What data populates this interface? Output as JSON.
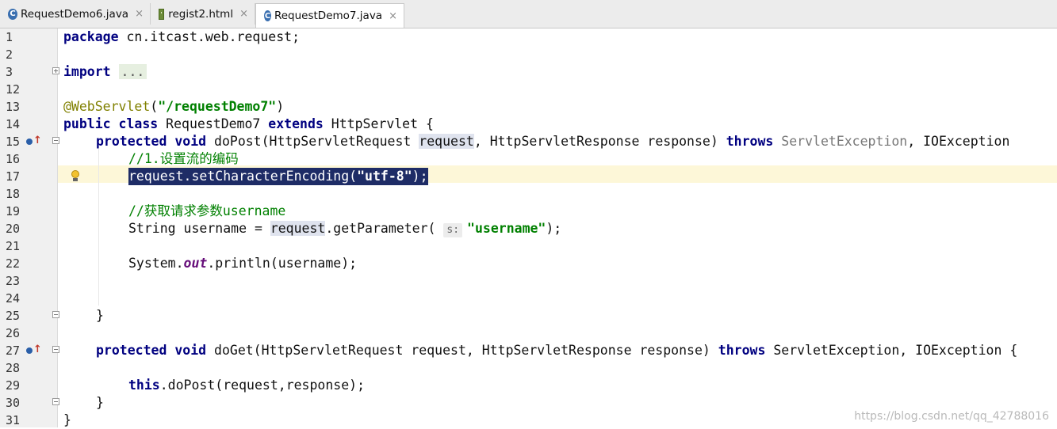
{
  "tabs": [
    {
      "label": "RequestDemo6.java",
      "icon": "class-icon",
      "close": "×"
    },
    {
      "label": "regist2.html",
      "icon": "html-file-icon",
      "close": "×"
    },
    {
      "label": "RequestDemo7.java",
      "icon": "class-icon",
      "close": "×",
      "active": true
    }
  ],
  "tab_icon_letter": "C",
  "lines": [
    {
      "n": "1"
    },
    {
      "n": "2"
    },
    {
      "n": "3"
    },
    {
      "n": "12"
    },
    {
      "n": "13"
    },
    {
      "n": "14"
    },
    {
      "n": "15"
    },
    {
      "n": "16"
    },
    {
      "n": "17"
    },
    {
      "n": "18"
    },
    {
      "n": "19"
    },
    {
      "n": "20"
    },
    {
      "n": "21"
    },
    {
      "n": "22"
    },
    {
      "n": "23"
    },
    {
      "n": "24"
    },
    {
      "n": "25"
    },
    {
      "n": "26"
    },
    {
      "n": "27"
    },
    {
      "n": "28"
    },
    {
      "n": "29"
    },
    {
      "n": "30"
    },
    {
      "n": "31"
    }
  ],
  "code": {
    "l1_kw": "package",
    "l1_rest": " cn.itcast.web.request;",
    "l3_kw": "import",
    "l3_dots": "...",
    "l13_ann": "@WebServlet",
    "l13_p1": "(",
    "l13_str": "\"/requestDemo7\"",
    "l13_p2": ")",
    "l14_kw1": "public class",
    "l14_mid": " RequestDemo7 ",
    "l14_kw2": "extends",
    "l14_rest": " HttpServlet {",
    "l15_kw1": "protected void",
    "l15_a": " doPost(HttpServletRequest ",
    "l15_req": "request",
    "l15_b": ", HttpServletResponse response) ",
    "l15_kw2": "throws",
    "l15_c": " ServletException",
    "l15_d": ", IOException",
    "l16_cmt": "//1.设置流的编码",
    "l17_a": "request.setCharacterEncoding(",
    "l17_str": "\"utf-8\"",
    "l17_b": ");",
    "l19_cmt": "//获取请求参数username",
    "l20_a": "String username = ",
    "l20_req": "request",
    "l20_b": ".getParameter( ",
    "l20_hint": "s:",
    "l20_str": "\"username\"",
    "l20_c": ");",
    "l22_a": "System.",
    "l22_out": "out",
    "l22_b": ".println(username);",
    "l25": "}",
    "l27_kw1": "protected void",
    "l27_a": " doGet(HttpServletRequest request, HttpServletResponse response) ",
    "l27_kw2": "throws",
    "l27_b": " ServletException, IOException {",
    "l29_kw": "this",
    "l29_a": ".doPost(request,response);",
    "l30": "}",
    "l31": "}"
  },
  "watermark": "https://blog.csdn.net/qq_42788016",
  "colors": {
    "keyword": "#000080",
    "string": "#008000",
    "annotation": "#808000",
    "selection": "#1e2c66"
  }
}
